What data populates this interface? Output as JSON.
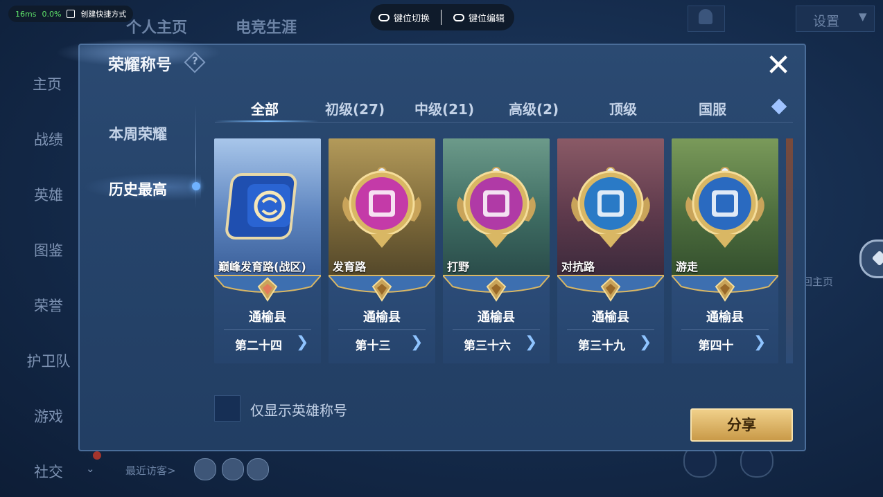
{
  "overlay": {
    "latency": "16ms",
    "cpu": "0.0%",
    "shortcut_label": "创建快捷方式",
    "key_switch": "键位切换",
    "key_edit": "键位编辑"
  },
  "background": {
    "tabs": [
      "个人主页",
      "电竞生涯"
    ],
    "settings_label": "设置",
    "nav_items": [
      "主页",
      "战绩",
      "英雄",
      "图鉴",
      "荣誉",
      "护卫队",
      "游戏",
      "社交"
    ],
    "home_link": "回主页",
    "recent_visitors": "最近访客>"
  },
  "dialog": {
    "title": "荣耀称号",
    "side_tabs": [
      "本周荣耀",
      "历史最高"
    ],
    "active_side_tab": "历史最高",
    "tabs": [
      "全部",
      "初级(27)",
      "中级(21)",
      "高级(2)",
      "顶级",
      "国服"
    ],
    "active_tab": "全部",
    "cards": [
      {
        "name": "巅峰发育路(战区)",
        "region": "通榆县",
        "rank": "第二十四",
        "theme": "blue"
      },
      {
        "name": "发育路",
        "region": "通榆县",
        "rank": "第十三",
        "theme": "olive"
      },
      {
        "name": "打野",
        "region": "通榆县",
        "rank": "第三十六",
        "theme": "teal"
      },
      {
        "name": "对抗路",
        "region": "通榆县",
        "rank": "第三十九",
        "theme": "maroon"
      },
      {
        "name": "游走",
        "region": "通榆县",
        "rank": "第四十",
        "theme": "green"
      }
    ],
    "checkbox_label": "仅显示英雄称号",
    "checkbox_checked": false,
    "share_label": "分享"
  },
  "colors": {
    "accent_blue": "#7dbfff",
    "gold": "#c99a48",
    "panel": "#26446b"
  }
}
